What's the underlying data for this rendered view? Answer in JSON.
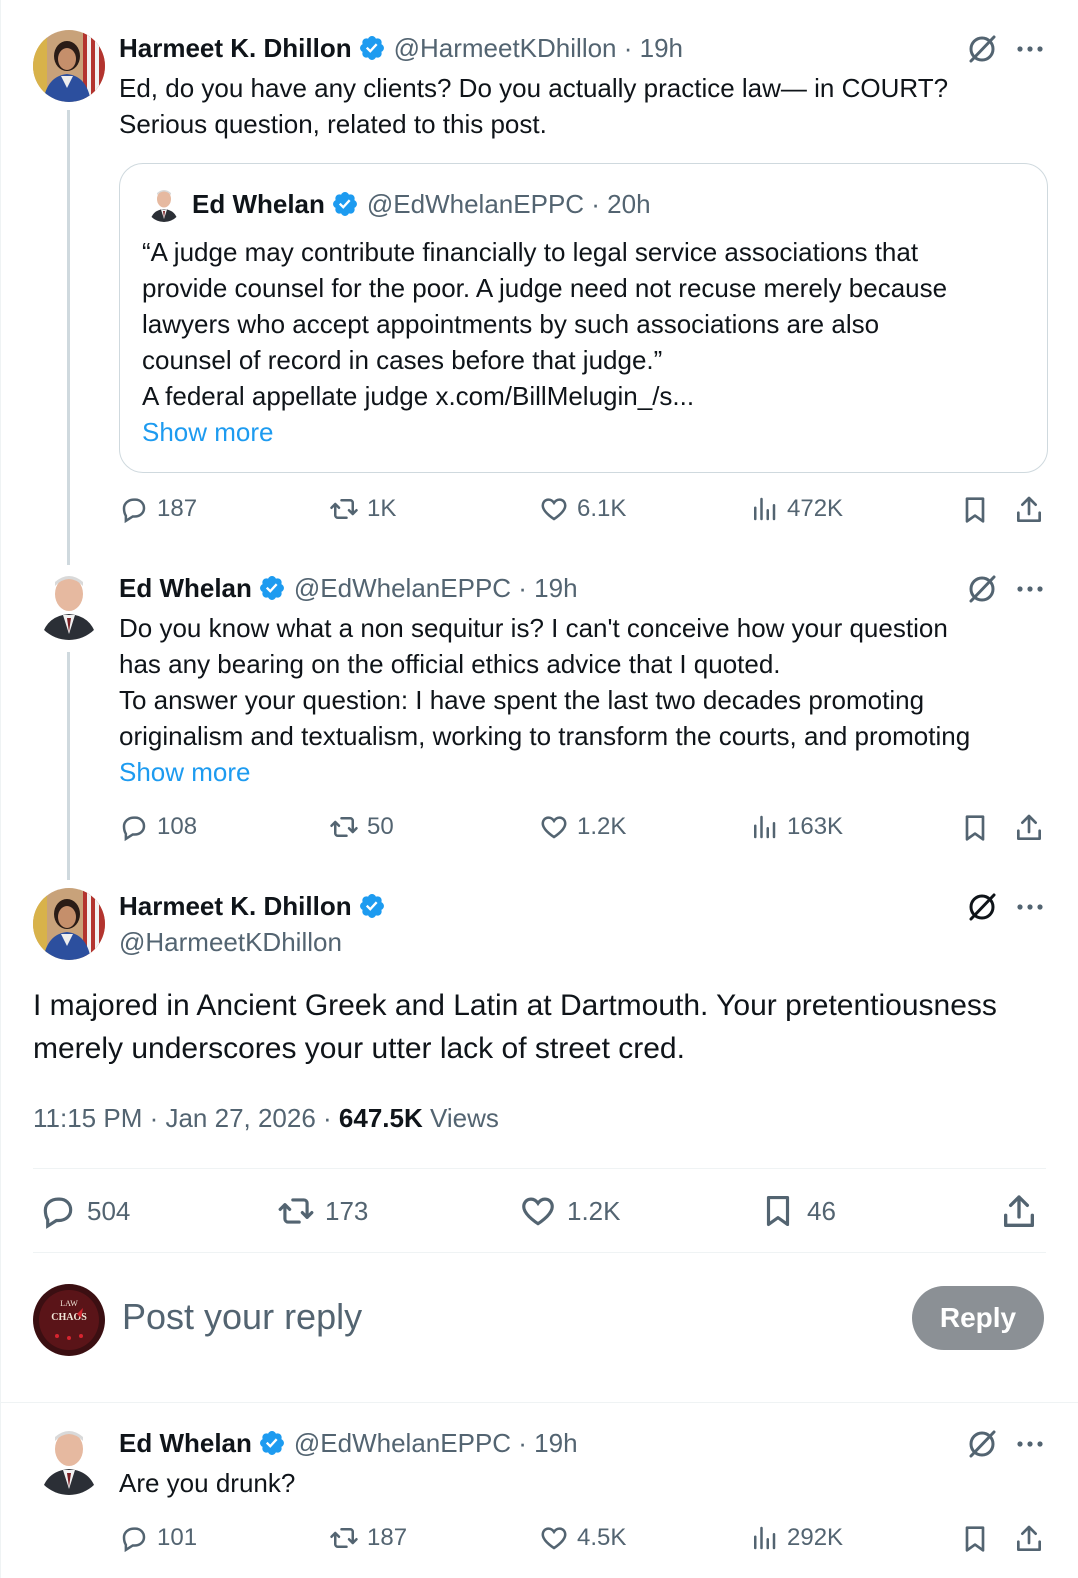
{
  "colors": {
    "accent": "#1d9bf0",
    "muted": "#536471",
    "text": "#0f1419",
    "reply_button": "#8b9095"
  },
  "tweet1": {
    "name": "Harmeet K. Dhillon",
    "handle_time": "@HarmeetKDhillon · 19h",
    "text_lines": [
      "Ed, do you have any clients? Do you actually practice law— in COURT?",
      "Serious question, related to this post."
    ],
    "quote": {
      "name": "Ed Whelan",
      "handle_time": "@EdWhelanEPPC · 20h",
      "lines": [
        "“A judge may contribute financially to legal service associations that",
        "provide counsel for the poor. A judge need not recuse merely because",
        "lawyers who accept appointments by such associations are also",
        "counsel of record in cases before that judge.”",
        "A federal appellate judge x.com/BillMelugin_/s..."
      ],
      "show_more": "Show more"
    },
    "stats": {
      "replies": "187",
      "reposts": "1K",
      "likes": "6.1K",
      "views": "472K"
    }
  },
  "tweet2": {
    "name": "Ed Whelan",
    "handle_time": "@EdWhelanEPPC · 19h",
    "text_lines": [
      "Do you know what a non sequitur is? I can't conceive how your question",
      "has any bearing on the official ethics advice that I quoted.",
      "To answer your question: I have spent the last two decades promoting",
      "originalism and textualism, working to transform the courts, and promoting"
    ],
    "show_more": "Show more",
    "stats": {
      "replies": "108",
      "reposts": "50",
      "likes": "1.2K",
      "views": "163K"
    }
  },
  "main": {
    "name": "Harmeet K. Dhillon",
    "handle": "@HarmeetKDhillon",
    "text_lines": [
      "I majored in Ancient Greek and Latin at Dartmouth. Your pretentiousness",
      "merely underscores your utter lack of street cred."
    ],
    "timestamp": "11:15 PM · Jan 27, 2026 · ",
    "views_count": "647.5K",
    "views_label": " Views",
    "stats": {
      "replies": "504",
      "reposts": "173",
      "likes": "1.2K",
      "bookmarks": "46"
    }
  },
  "composer": {
    "placeholder": "Post your reply",
    "button": "Reply",
    "avatar_text": [
      "LAW",
      "CHAOS"
    ]
  },
  "tweet3": {
    "name": "Ed Whelan",
    "handle_time": "@EdWhelanEPPC · 19h",
    "text": "Are you drunk?",
    "stats": {
      "replies": "101",
      "reposts": "187",
      "likes": "4.5K",
      "views": "292K"
    }
  }
}
